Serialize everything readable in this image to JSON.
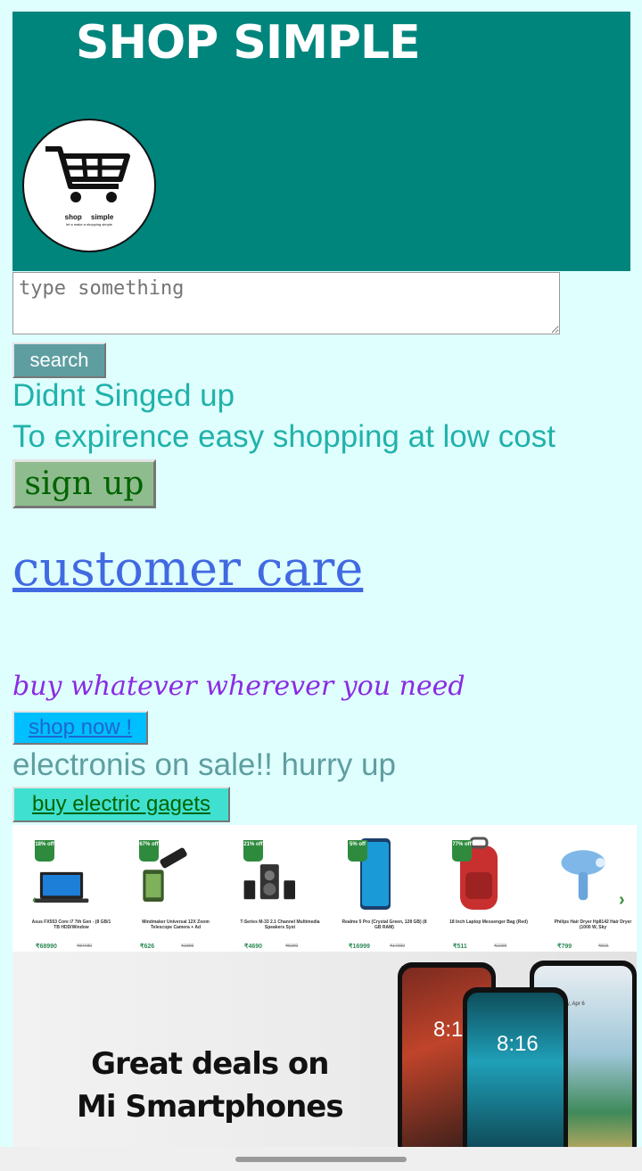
{
  "header": {
    "title": "SHOP SIMPLE",
    "logo": {
      "name": "shop simple",
      "tagline": "let a make a shopping simple"
    }
  },
  "search": {
    "placeholder": "type something",
    "button_label": "search"
  },
  "signup": {
    "prompt": "Didnt Singed up",
    "subtext": "To expirence easy shopping at low cost",
    "button_label": "sign up"
  },
  "customer_care": {
    "label": "customer care"
  },
  "promo": {
    "tagline": "buy whatever wherever you need",
    "shop_button": "shop now !",
    "sale_text": "electronis on sale!! hurry up",
    "electronics_button": "buy electric gagets"
  },
  "products": [
    {
      "badge": "18% off",
      "name": "Asus FX553 Core i7 7th Gen - (8 GB/1 TB HDD/Window",
      "price": "₹68990",
      "old_price": "₹84480",
      "icon": "laptop-icon"
    },
    {
      "badge": "67% off",
      "name": "Mindmaker Universal 12X Zoom Telescope Camera + Ad",
      "price": "₹626",
      "old_price": "₹1899",
      "icon": "telescope-icon"
    },
    {
      "badge": "21% off",
      "name": "T-Series M-33 2.1 Channel Multimedia Speakers Syst",
      "price": "₹4690",
      "old_price": "₹5990",
      "icon": "speakers-icon"
    },
    {
      "badge": "5% off",
      "name": "Realme 5 Pro (Crystal Green, 128 GB) (8 GB RAM)",
      "price": "₹16999",
      "old_price": "₹17999",
      "icon": "smartphone-icon"
    },
    {
      "badge": "77% off",
      "name": "18 Inch Laptop Messenger Bag (Red)",
      "price": "₹511",
      "old_price": "₹2299",
      "icon": "backpack-icon"
    },
    {
      "badge": "",
      "name": "Philips Hair Dryer Hp8142 Hair Dryer (1000 W, Sky",
      "price": "₹799",
      "old_price": "₹816",
      "icon": "hair-dryer-icon"
    }
  ],
  "banner": {
    "line1": "Great deals on",
    "line2": "Mi Smartphones",
    "screen_time": "8:16",
    "screen_date": "Tuesday, Apr 6"
  },
  "colors": {
    "background": "#dfffff",
    "header": "#00857d",
    "teal_text": "#20b2aa",
    "link": "#4169e1",
    "tagline": "#8a2be2"
  }
}
